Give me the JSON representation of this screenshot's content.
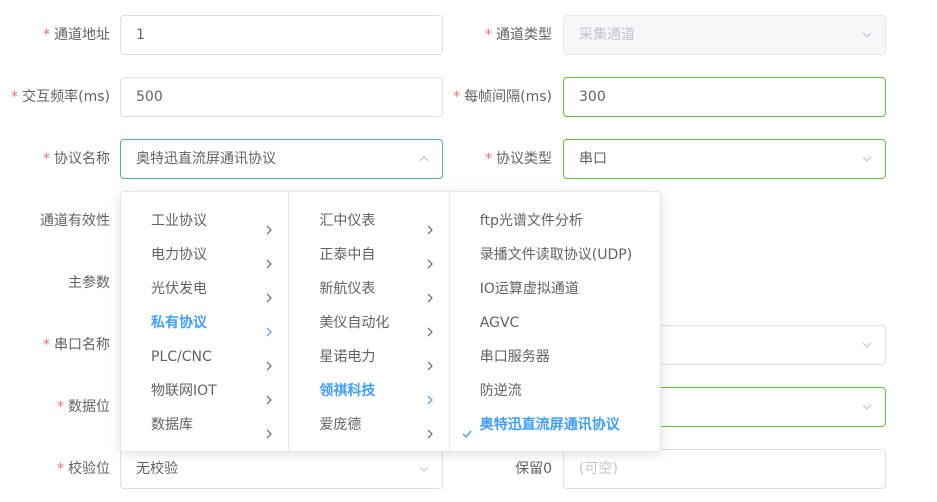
{
  "form": {
    "channel_address": {
      "label": "通道地址",
      "value": "1"
    },
    "channel_type": {
      "label": "通道类型",
      "value": "采集通道"
    },
    "interaction_freq": {
      "label": "交互频率(ms)",
      "value": "500"
    },
    "frame_interval": {
      "label": "每帧间隔(ms)",
      "value": "300"
    },
    "protocol_name": {
      "label": "协议名称",
      "value": "奥特迅直流屏通讯协议"
    },
    "protocol_type": {
      "label": "协议类型",
      "value": "串口"
    },
    "channel_validity": {
      "label": "通道有效性"
    },
    "main_param": {
      "label": "主参数"
    },
    "serial_name": {
      "label": "串口名称"
    },
    "data_bits": {
      "label": "数据位"
    },
    "parity": {
      "label": "校验位",
      "value": "无校验"
    },
    "reserved0": {
      "label": "保留0",
      "placeholder": "(可空)"
    }
  },
  "cascader": {
    "level1": [
      "工业协议",
      "电力协议",
      "光伏发电",
      "私有协议",
      "PLC/CNC",
      "物联网IOT",
      "数据库"
    ],
    "level1_active": 3,
    "level2": [
      "汇中仪表",
      "正泰中自",
      "新航仪表",
      "美仪自动化",
      "星诺电力",
      "领祺科技",
      "爱庞德"
    ],
    "level2_active": 5,
    "level3": [
      "ftp光谱文件分析",
      "录播文件读取协议(UDP)",
      "IO运算虚拟通道",
      "AGVC",
      "串口服务器",
      "防逆流",
      "奥特迅直流屏通讯协议"
    ],
    "level3_active": 6
  },
  "colors": {
    "required": "#f56c6c",
    "active": "#409eff",
    "success_border": "#67c23a"
  }
}
